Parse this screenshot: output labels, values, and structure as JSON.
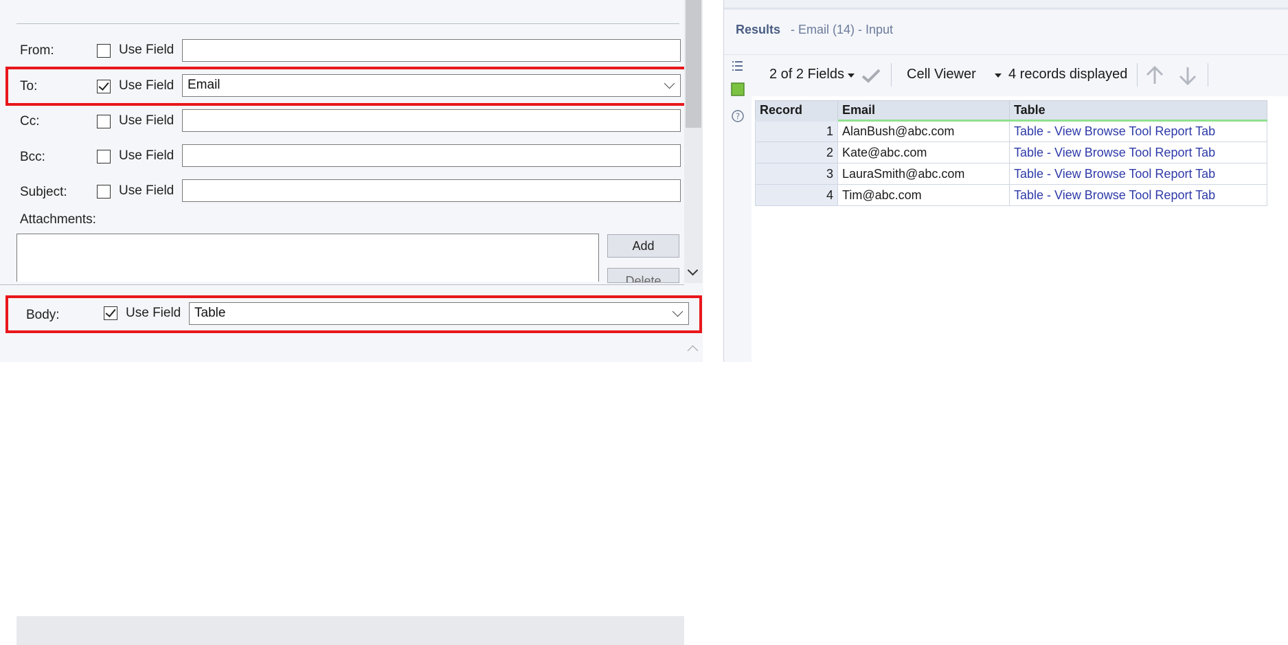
{
  "config": {
    "rows": [
      {
        "id": "from",
        "label": "From:",
        "use_field_label": "Use Field",
        "checked": false,
        "value": ""
      },
      {
        "id": "to",
        "label": "To:",
        "use_field_label": "Use Field",
        "checked": true,
        "value": "Email"
      },
      {
        "id": "cc",
        "label": "Cc:",
        "use_field_label": "Use Field",
        "checked": false,
        "value": ""
      },
      {
        "id": "bcc",
        "label": "Bcc:",
        "use_field_label": "Use Field",
        "checked": false,
        "value": ""
      },
      {
        "id": "subject",
        "label": "Subject:",
        "use_field_label": "Use Field",
        "checked": false,
        "value": ""
      }
    ],
    "attachments_label": "Attachments:",
    "add_button": "Add",
    "delete_button": "Delete",
    "body": {
      "label": "Body:",
      "use_field_label": "Use Field",
      "checked": true,
      "value": "Table"
    },
    "highlight_color": "#e8171c"
  },
  "results": {
    "title": "Results",
    "subtitle": "- Email (14) - Input",
    "toolbar": {
      "fields": "2 of 2 Fields",
      "cell_viewer": "Cell Viewer",
      "records_displayed": "4 records displayed"
    },
    "table": {
      "columns": [
        "Record",
        "Email",
        "Table"
      ],
      "rows": [
        {
          "record": "1",
          "email": "AlanBush@abc.com",
          "table": "Table - View Browse Tool Report Tab"
        },
        {
          "record": "2",
          "email": "Kate@abc.com",
          "table": "Table - View Browse Tool Report Tab"
        },
        {
          "record": "3",
          "email": "LauraSmith@abc.com",
          "table": "Table - View Browse Tool Report Tab"
        },
        {
          "record": "4",
          "email": "Tim@abc.com",
          "table": "Table - View Browse Tool Report Tab"
        }
      ]
    },
    "link_color": "#2e3aa8"
  }
}
